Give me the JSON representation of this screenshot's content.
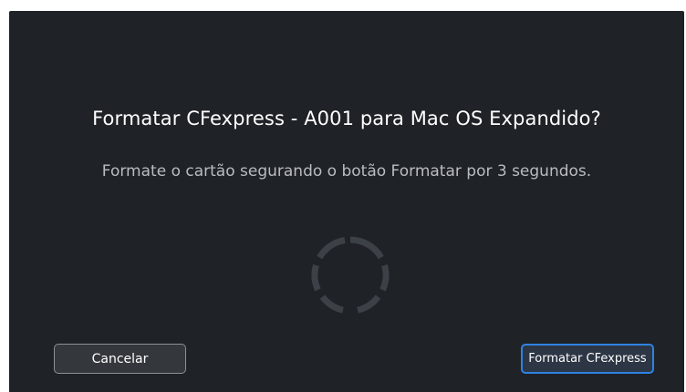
{
  "dialog": {
    "title": "Formatar CFexpress - A001 para Mac OS Expandido?",
    "message": "Formate o cartão segurando o botão Formatar por 3 segundos.",
    "spinner_icon": "progress-ring-icon"
  },
  "buttons": {
    "cancel_label": "Cancelar",
    "format_label": "Formatar CFexpress"
  },
  "colors": {
    "background": "#1f2226",
    "accent": "#2f82e3",
    "text_primary": "#ffffff",
    "text_secondary": "#b9bcc0"
  }
}
